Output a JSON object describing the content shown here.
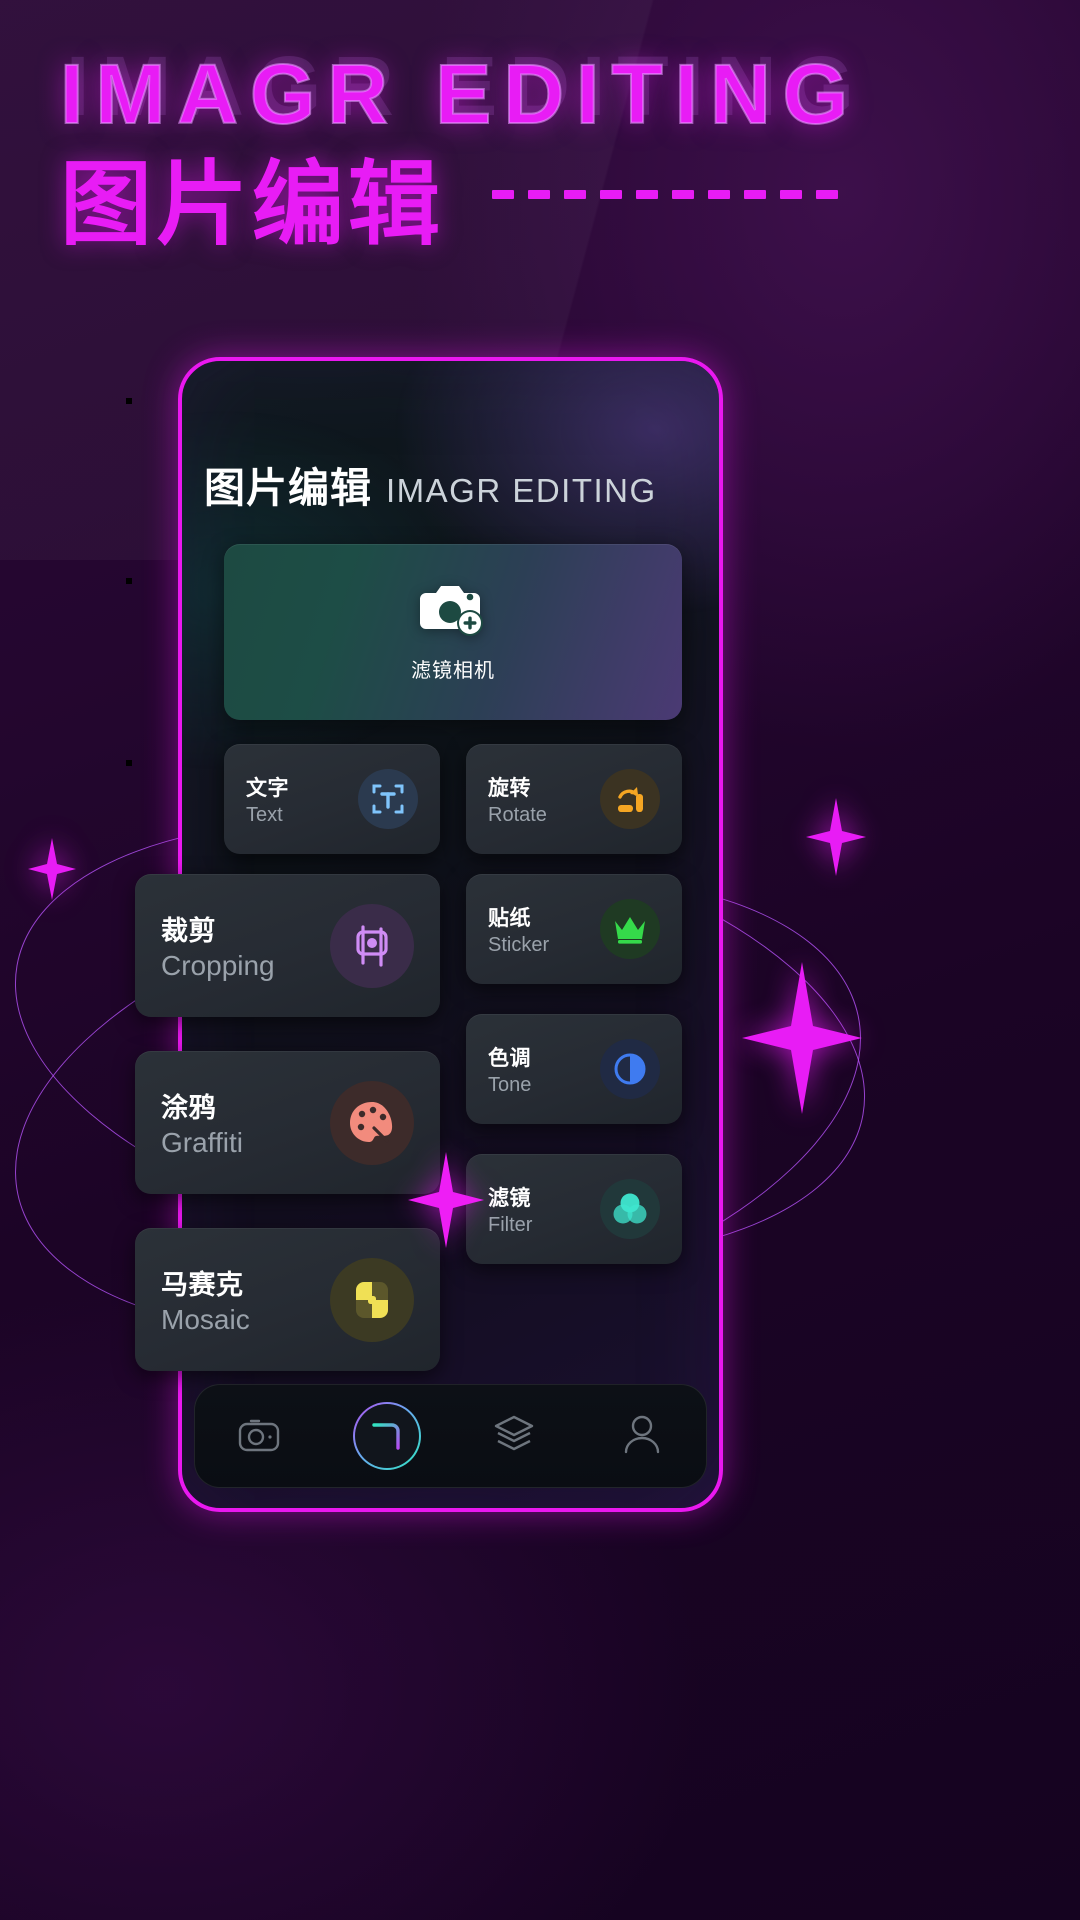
{
  "poster": {
    "headline_en": "IMAGR EDITING",
    "headline_cn": "图片编辑",
    "dash_count": 10,
    "accent_magenta": "#e81cf5",
    "accent_blue": "#2bb0f0",
    "accent_purple": "#ba55ff",
    "background": "#1a0424"
  },
  "phone": {
    "screen": {
      "title_cn": "图片编辑",
      "title_en": "IMAGR EDITING",
      "feature_card": {
        "label": "滤镜相机",
        "icon": "camera-plus-icon"
      },
      "tiles": [
        {
          "id": "text",
          "cn": "文字",
          "en": "Text",
          "icon": "text-frame-icon",
          "icon_color": "#7fc4fb",
          "bubble_color": "#2b3a4f"
        },
        {
          "id": "rotate",
          "cn": "旋转",
          "en": "Rotate",
          "icon": "rotate-icon",
          "icon_color": "#f5a623",
          "bubble_color": "#3b3322"
        },
        {
          "id": "cropping",
          "cn": "裁剪",
          "en": "Cropping",
          "icon": "crop-icon",
          "icon_color": "#cf8cf5",
          "bubble_color": "#3a2c49"
        },
        {
          "id": "sticker",
          "cn": "贴纸",
          "en": "Sticker",
          "icon": "crown-icon",
          "icon_color": "#35d94a",
          "bubble_color": "#1f3a23"
        },
        {
          "id": "graffiti",
          "cn": "涂鸦",
          "en": "Graffiti",
          "icon": "palette-icon",
          "icon_color": "#f28b7d",
          "bubble_color": "#3d2b2a"
        },
        {
          "id": "tone",
          "cn": "色调",
          "en": "Tone",
          "icon": "contrast-icon",
          "icon_color": "#3f7bf0",
          "bubble_color": "#202a44"
        },
        {
          "id": "mosaic",
          "cn": "马赛克",
          "en": "Mosaic",
          "icon": "mosaic-icon",
          "icon_color": "#f0e055",
          "bubble_color": "#3c3a23"
        },
        {
          "id": "filter",
          "cn": "滤镜",
          "en": "Filter",
          "icon": "filter-circles-icon",
          "icon_color": "#3fe6cf",
          "bubble_color": "#21383a"
        }
      ],
      "navbar": [
        {
          "id": "camera",
          "icon": "camera-outline-icon"
        },
        {
          "id": "capture",
          "icon": "capture-ring-icon"
        },
        {
          "id": "layers",
          "icon": "layers-icon"
        },
        {
          "id": "profile",
          "icon": "person-icon"
        }
      ]
    }
  }
}
